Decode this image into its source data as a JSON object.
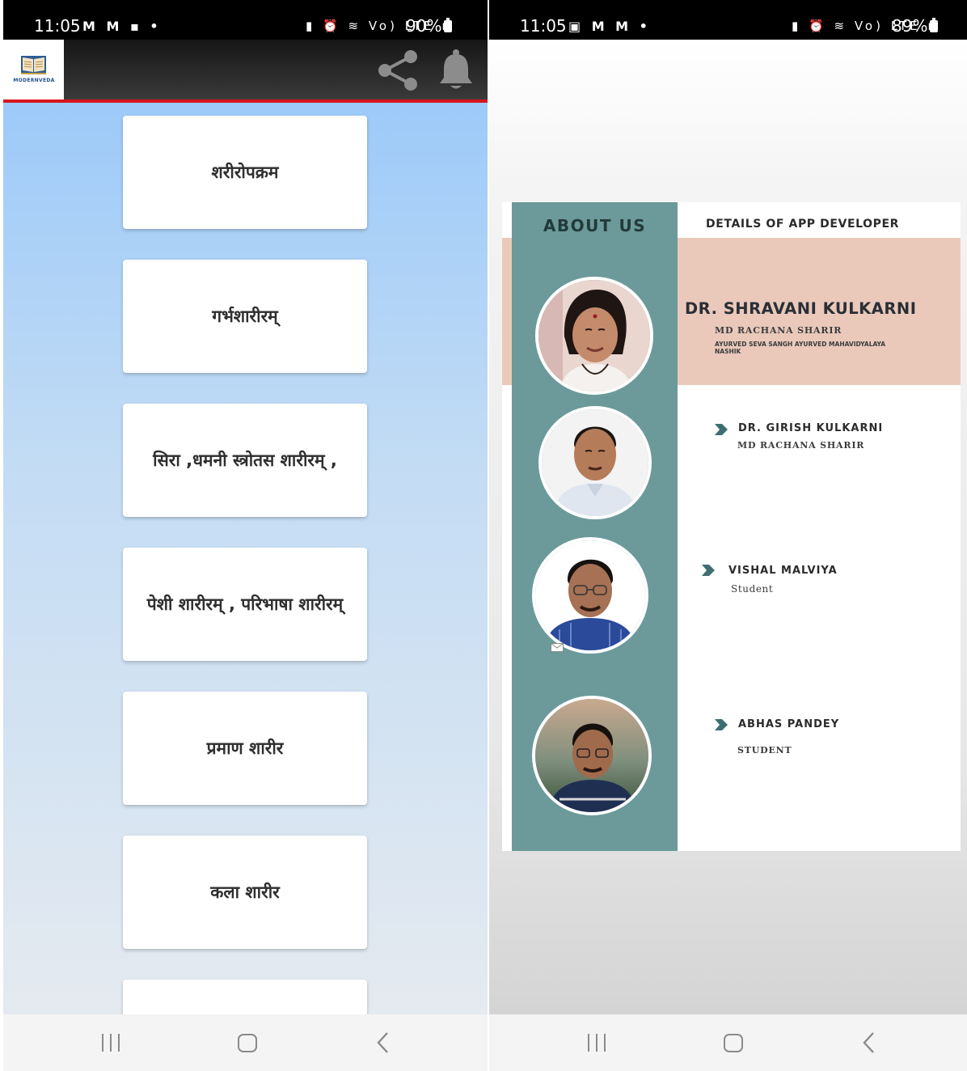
{
  "left_screen": {
    "status_bar": {
      "time": "11:05",
      "left_icons": "M M ▪ •",
      "right_icons": "Vo) LTE",
      "battery": "90%"
    },
    "app_bar": {
      "logo_text": "MODERNVEDA",
      "icons": [
        "share-icon",
        "bell-icon"
      ]
    },
    "menu": [
      "शरीरोपक्रम",
      "गर्भशारीरम्",
      "सिरा ,धमनी स्त्रोतस शारीरम् ,",
      "पेशी शारीरम् , परिभाषा शारीरम्",
      "प्रमाण शारीर",
      "कला शारीर",
      ""
    ]
  },
  "right_screen": {
    "status_bar": {
      "time": "11:05",
      "left_icons": "▣ M M •",
      "right_icons": "Vo) LTE",
      "battery": "89%"
    },
    "poster": {
      "about_title": "ABOUT US",
      "details_title": "DETAILS OF APP DEVELOPER",
      "main_developer": {
        "name": "DR. SHRAVANI KULKARNI",
        "degree": "MD RACHANA SHARIR",
        "institute": "AYURVED SEVA SANGH AYURVED MAHAVIDYALAYA NASHIK"
      },
      "members": [
        {
          "name": "DR. GIRISH KULKARNI",
          "role": "MD RACHANA SHARIR"
        },
        {
          "name": "VISHAL MALVIYA",
          "role": "Student"
        },
        {
          "name": "ABHAS PANDEY",
          "role": "STUDENT"
        }
      ]
    }
  },
  "colors": {
    "app_bar_accent": "#d8151c",
    "poster_teal": "#6c9a9a",
    "poster_peach": "#eac9bb",
    "arrow_teal": "#3d6f72"
  }
}
